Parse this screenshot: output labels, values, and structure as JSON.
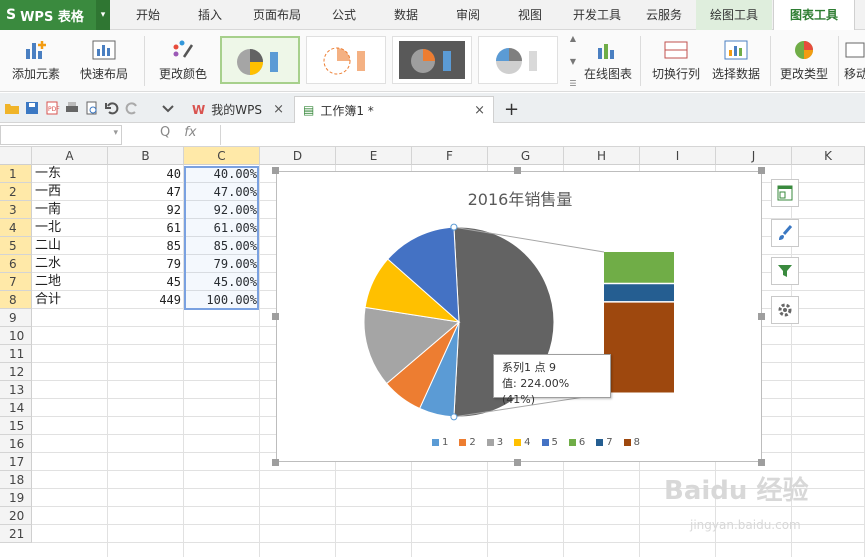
{
  "app": {
    "title": "WPS 表格",
    "logo": "S"
  },
  "menu": {
    "tabs": [
      "开始",
      "插入",
      "页面布局",
      "公式",
      "数据",
      "审阅",
      "视图",
      "开发工具",
      "云服务",
      "绘图工具",
      "图表工具"
    ],
    "active": "图表工具"
  },
  "ribbon": {
    "add_element": "添加元素",
    "quick_layout": "快速布局",
    "change_color": "更改颜色",
    "online_chart": "在线图表",
    "switch_row_col": "切换行列",
    "select_data": "选择数据",
    "change_type": "更改类型",
    "move": "移动"
  },
  "doc_tabs": [
    {
      "label": "我的WPS",
      "close": "×"
    },
    {
      "label": "工作簿1 *",
      "close": "×"
    }
  ],
  "new_tab": "+",
  "formula_bar": {
    "fx": "fx",
    "zoom_glyph": "Q"
  },
  "columns": [
    "A",
    "B",
    "C",
    "D",
    "E",
    "F",
    "G",
    "H",
    "I",
    "J",
    "K"
  ],
  "rows": [
    "1",
    "2",
    "3",
    "4",
    "5",
    "6",
    "7",
    "8",
    "9",
    "10",
    "11",
    "12",
    "13",
    "14",
    "15",
    "16",
    "17",
    "18",
    "19",
    "20",
    "21"
  ],
  "table": [
    {
      "a": "一东",
      "b": "40",
      "c": "40.00%"
    },
    {
      "a": "一西",
      "b": "47",
      "c": "47.00%"
    },
    {
      "a": "一南",
      "b": "92",
      "c": "92.00%"
    },
    {
      "a": "一北",
      "b": "61",
      "c": "61.00%"
    },
    {
      "a": "二山",
      "b": "85",
      "c": "85.00%"
    },
    {
      "a": "二水",
      "b": "79",
      "c": "79.00%"
    },
    {
      "a": "二地",
      "b": "45",
      "c": "45.00%"
    },
    {
      "a": "合计",
      "b": "449",
      "c": "100.00%"
    }
  ],
  "chart_data": {
    "type": "pie",
    "subtype": "bar-of-pie",
    "title": "2016年销售量",
    "categories": [
      "1",
      "2",
      "3",
      "4",
      "5",
      "6",
      "7",
      "8"
    ],
    "values": [
      40,
      47,
      92,
      61,
      85,
      79,
      45,
      224
    ],
    "pie_points": [
      1,
      2,
      3,
      4,
      5,
      9
    ],
    "bar_points": [
      6,
      7,
      8
    ],
    "colors": [
      "#5b9bd5",
      "#ed7d31",
      "#a5a5a5",
      "#ffc000",
      "#4472c4",
      "#70ad47",
      "#255e91",
      "#9e480e",
      "#636363"
    ],
    "legend_position": "bottom",
    "tooltip": {
      "series": "系列1 点 9",
      "value": "值: 224.00%(41%)"
    }
  },
  "icons": {
    "chart_elements": "chart-elements-icon",
    "chart_style": "paintbrush-icon",
    "chart_filter": "filter-icon",
    "chart_settings": "gear-icon"
  },
  "watermark": {
    "main": "Baidu 经验",
    "sub": "jingyan.baidu.com"
  }
}
